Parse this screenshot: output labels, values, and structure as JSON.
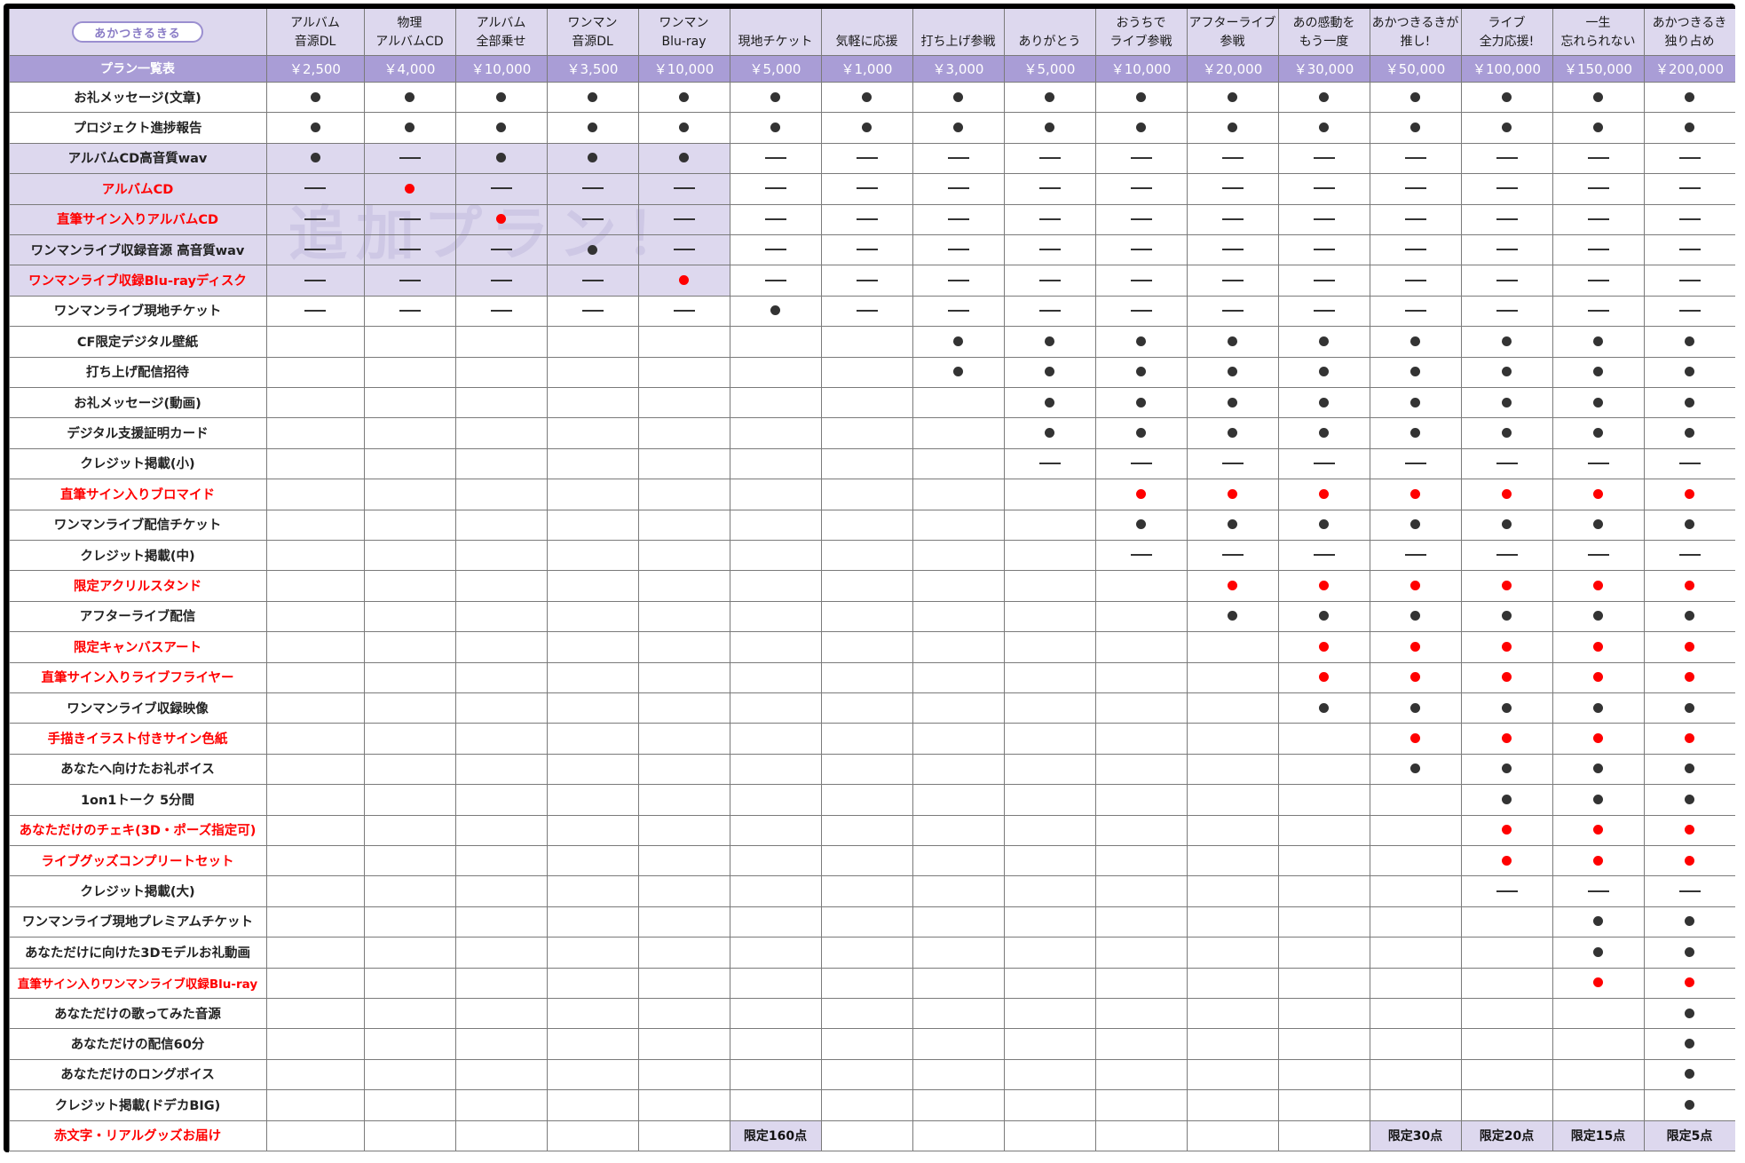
{
  "colors": {
    "header_bg": "#ddd8ee",
    "price_bg": "#a99dd6",
    "section_bg": "#ddd8ee",
    "red": "#ff0000",
    "dot": "#333333"
  },
  "table": {
    "logo_text": "あかつきるきる",
    "price_row_label": "プラン一覧表",
    "watermark": "追加プラン！",
    "columns": [
      {
        "name": "アルバム\n音源DL",
        "price": "￥2,500",
        "limit": ""
      },
      {
        "name": "物理\nアルバムCD",
        "price": "￥4,000",
        "limit": ""
      },
      {
        "name": "アルバム\n全部乗せ",
        "price": "￥10,000",
        "limit": ""
      },
      {
        "name": "ワンマン\n音源DL",
        "price": "￥3,500",
        "limit": ""
      },
      {
        "name": "ワンマン\nBlu-ray",
        "price": "￥10,000",
        "limit": ""
      },
      {
        "name": "現地チケット",
        "price": "￥5,000",
        "limit": "限定160点"
      },
      {
        "name": "気軽に応援",
        "price": "￥1,000",
        "limit": ""
      },
      {
        "name": "打ち上げ参戦",
        "price": "￥3,000",
        "limit": ""
      },
      {
        "name": "ありがとう",
        "price": "￥5,000",
        "limit": ""
      },
      {
        "name": "おうちで\nライブ参戦",
        "price": "￥10,000",
        "limit": ""
      },
      {
        "name": "アフターライブ\n参戦",
        "price": "￥20,000",
        "limit": ""
      },
      {
        "name": "あの感動を\nもう一度",
        "price": "￥30,000",
        "limit": ""
      },
      {
        "name": "あかつきるきが\n推し!",
        "price": "￥50,000",
        "limit": "限定30点"
      },
      {
        "name": "ライブ\n全力応援!",
        "price": "￥100,000",
        "limit": "限定20点"
      },
      {
        "name": "一生\n忘れられない",
        "price": "￥150,000",
        "limit": "限定15点"
      },
      {
        "name": "あかつきるき\n独り占め",
        "price": "￥200,000",
        "limit": "限定5点"
      }
    ],
    "rows": [
      {
        "label": "お礼メッセージ(文章)",
        "red": false,
        "cells": "1111111111111111"
      },
      {
        "label": "プロジェクト進捗報告",
        "red": false,
        "cells": "1111111111111111"
      },
      {
        "label": "アルバムCD高音質wav",
        "red": false,
        "cells": "1-111-----------"
      },
      {
        "label": "アルバムCD",
        "red": true,
        "cells": "-r--------------"
      },
      {
        "label": "直筆サイン入りアルバムCD",
        "red": true,
        "cells": "--r-------------"
      },
      {
        "label": "ワンマンライブ収録音源 高音質wav",
        "red": false,
        "cells": "---1------------"
      },
      {
        "label": "ワンマンライブ収録Blu-rayディスク",
        "red": true,
        "cells": "----r-----------"
      },
      {
        "label": "ワンマンライブ現地チケット",
        "red": false,
        "cells": "-----1----------"
      },
      {
        "label": "CF限定デジタル壁紙",
        "red": false,
        "cells": "0000000111111111"
      },
      {
        "label": "打ち上げ配信招待",
        "red": false,
        "cells": "0000000111111111"
      },
      {
        "label": "お礼メッセージ(動画)",
        "red": false,
        "cells": "0000000011111111"
      },
      {
        "label": "デジタル支援証明カード",
        "red": false,
        "cells": "0000000011111111"
      },
      {
        "label": "クレジット掲載(小)",
        "red": false,
        "cells": "00000000--------"
      },
      {
        "label": "直筆サイン入りブロマイド",
        "red": true,
        "cells": "000000000rrrrrrr"
      },
      {
        "label": "ワンマンライブ配信チケット",
        "red": false,
        "cells": "0000000001111111"
      },
      {
        "label": "クレジット掲載(中)",
        "red": false,
        "cells": "000000000-------"
      },
      {
        "label": "限定アクリルスタンド",
        "red": true,
        "cells": "0000000000rrrrrr"
      },
      {
        "label": "アフターライブ配信",
        "red": false,
        "cells": "0000000000111111"
      },
      {
        "label": "限定キャンバスアート",
        "red": true,
        "cells": "00000000000rrrrr"
      },
      {
        "label": "直筆サイン入りライブフライヤー",
        "red": true,
        "cells": "00000000000rrrrr"
      },
      {
        "label": "ワンマンライブ収録映像",
        "red": false,
        "cells": "0000000000011111"
      },
      {
        "label": "手描きイラスト付きサイン色紙",
        "red": true,
        "cells": "000000000000rrrr"
      },
      {
        "label": "あなたへ向けたお礼ボイス",
        "red": false,
        "cells": "0000000000001111"
      },
      {
        "label": "1on1トーク 5分間",
        "red": false,
        "cells": "0000000000000111"
      },
      {
        "label": "あなただけのチェキ(3D・ポーズ指定可)",
        "red": true,
        "cells": "0000000000000rrr"
      },
      {
        "label": "ライブグッズコンプリートセット",
        "red": true,
        "cells": "0000000000000rrr"
      },
      {
        "label": "クレジット掲載(大)",
        "red": false,
        "cells": "0000000000000---"
      },
      {
        "label": "ワンマンライブ現地プレミアムチケット",
        "red": false,
        "cells": "0000000000000011"
      },
      {
        "label": "あなただけに向けた3Dモデルお礼動画",
        "red": false,
        "cells": "0000000000000011"
      },
      {
        "label": "直筆サイン入りワンマンライブ収録Blu-ray",
        "red": true,
        "cells": "00000000000000rr"
      },
      {
        "label": "あなただけの歌ってみた音源",
        "red": false,
        "cells": "0000000000000001"
      },
      {
        "label": "あなただけの配信60分",
        "red": false,
        "cells": "0000000000000001"
      },
      {
        "label": "あなただけのロングボイス",
        "red": false,
        "cells": "0000000000000001"
      },
      {
        "label": "クレジット掲載(ドデカBIG)",
        "red": false,
        "cells": "0000000000000001"
      },
      {
        "label": "赤文字・リアルグッズお届け",
        "red": true,
        "cells": "limit"
      }
    ]
  }
}
